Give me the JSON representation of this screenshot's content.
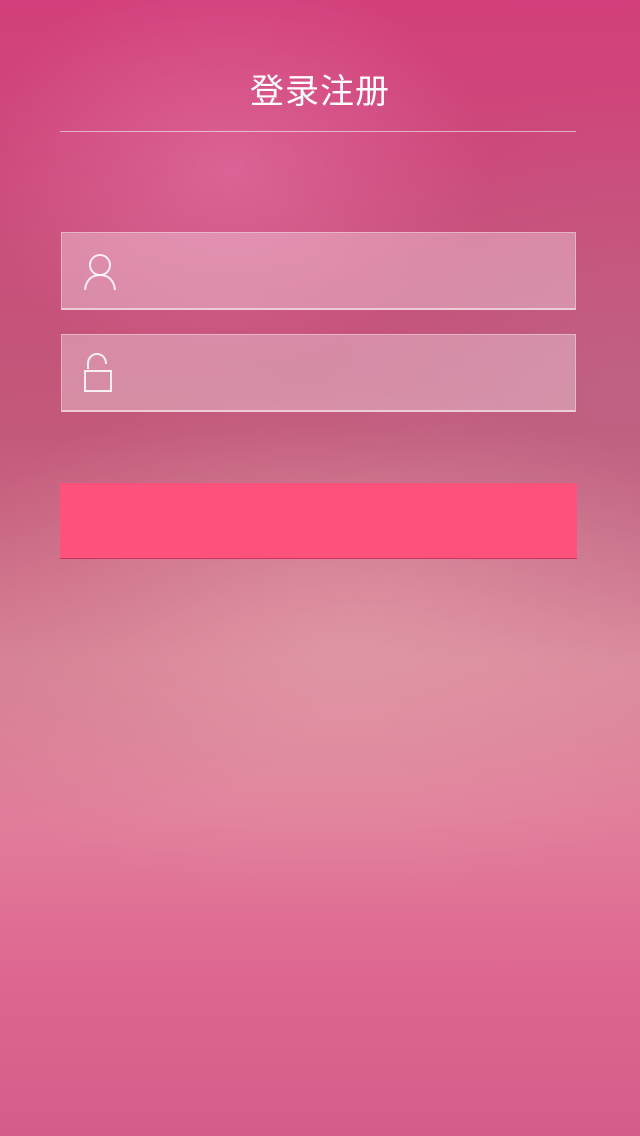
{
  "header": {
    "title": "登录注册"
  },
  "form": {
    "username": {
      "icon": "user-icon",
      "value": "",
      "placeholder": ""
    },
    "password": {
      "icon": "lock-icon",
      "value": "",
      "placeholder": ""
    },
    "submit": {
      "label": "",
      "color": "#fe527c"
    }
  },
  "colors": {
    "background_top": "#d33f7a",
    "background_bottom": "#d45c8b",
    "accent": "#fe527c"
  }
}
